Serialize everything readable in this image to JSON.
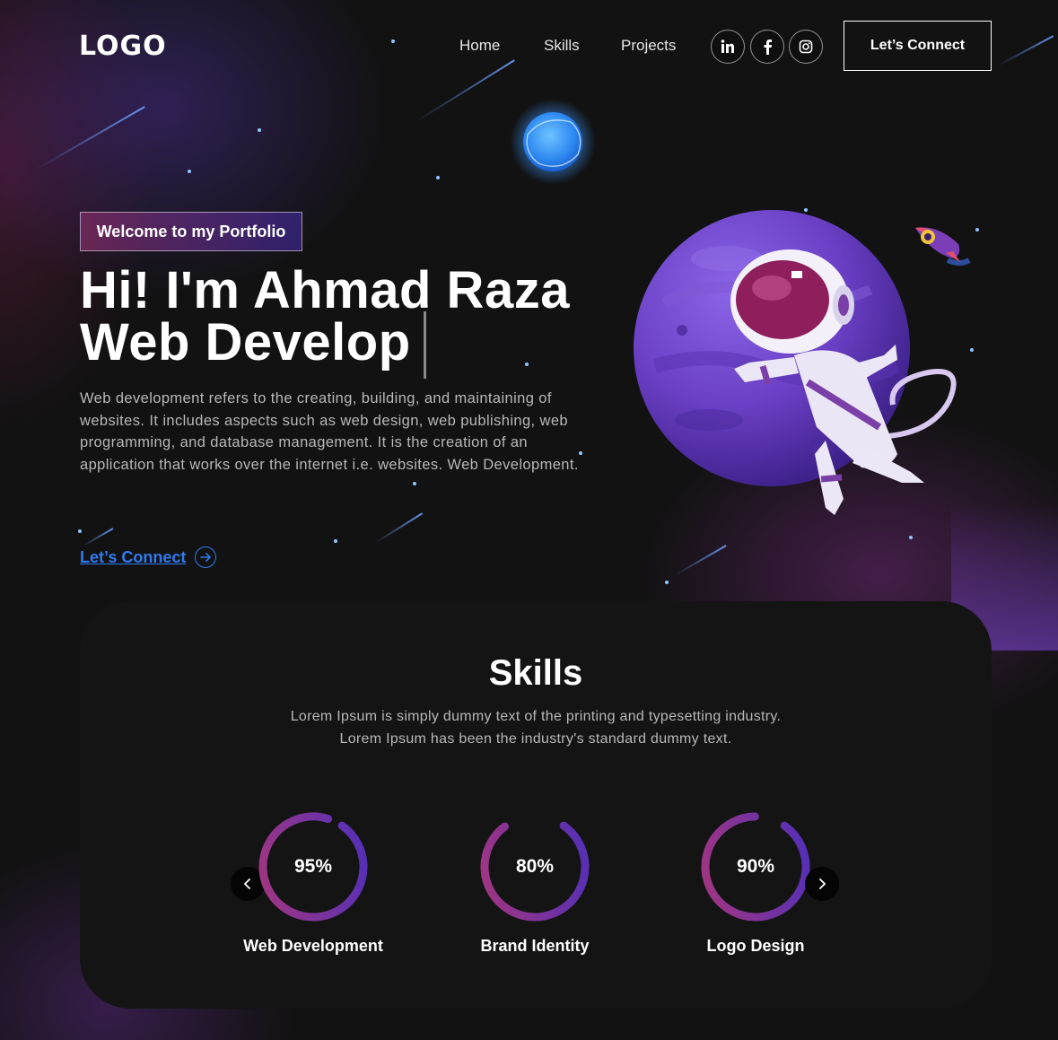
{
  "header": {
    "logo": "LOGO",
    "nav": [
      "Home",
      "Skills",
      "Projects"
    ],
    "socials": [
      "linkedin-icon",
      "facebook-icon",
      "instagram-icon"
    ],
    "connect_label": "Let’s Connect"
  },
  "hero": {
    "tagline": "Welcome to my Portfolio",
    "title_line1": "Hi! I'm Ahmad Raza",
    "title_line2": "Web Develop",
    "description": "Web development refers to the creating, building, and maintaining of websites. It includes aspects such as web design, web publishing, web programming, and database management. It is the creation of an application that works over the internet i.e. websites. Web Development.",
    "cta_label": "Let’s Connect"
  },
  "skills": {
    "title": "Skills",
    "description_line1": "Lorem Ipsum is simply dummy text of the printing and typesetting industry.",
    "description_line2": "Lorem Ipsum has been the industry's standard dummy text.",
    "items": [
      {
        "label": "95%",
        "value": 95,
        "name": "Web Development"
      },
      {
        "label": "80%",
        "value": 80,
        "name": "Brand Identity"
      },
      {
        "label": "90%",
        "value": 90,
        "name": "Logo Design"
      }
    ]
  },
  "colors": {
    "accent_blue": "#2f7bf0",
    "gauge_start": "#aa367c",
    "gauge_end": "#4a2fbd",
    "planet": "#6a3fc4",
    "background": "#121212"
  }
}
